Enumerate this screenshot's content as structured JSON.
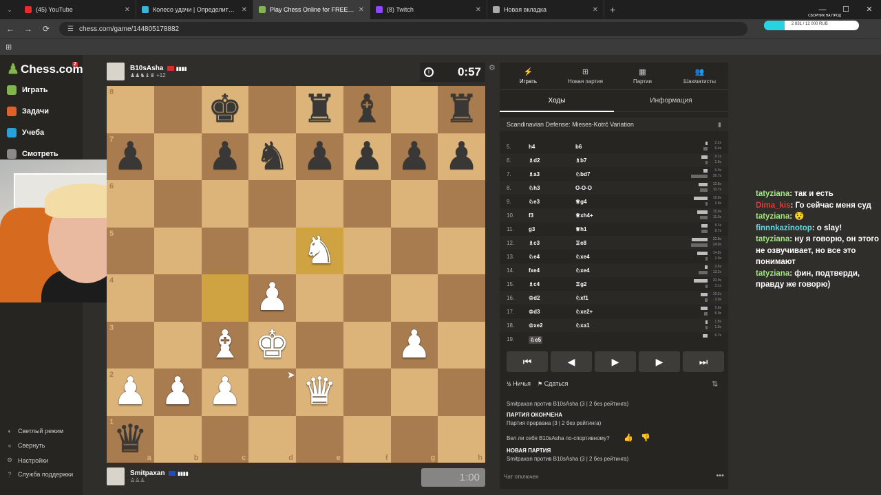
{
  "browser": {
    "tabs": [
      {
        "title": "(45) YouTube",
        "color": "#e52d27",
        "active": false
      },
      {
        "title": "Колесо удачи | Определите пс",
        "color": "#3bb3e0",
        "active": false
      },
      {
        "title": "Play Chess Online for FREE - 2",
        "color": "#81b64c",
        "active": true
      },
      {
        "title": "(8) Twitch",
        "color": "#9146ff",
        "active": false
      },
      {
        "title": "Новая вкладка",
        "color": "#aaa",
        "active": false
      }
    ],
    "url": "chess.com/game/144805178882",
    "promo_title": "СБОРНИК НА ПРОД",
    "promo_text": "2 831 / 12 000 RUB"
  },
  "sidebar": {
    "logo": "Chess.com",
    "badge": "2",
    "items": [
      {
        "label": "Играть",
        "color": "#81b64c"
      },
      {
        "label": "Задачи",
        "color": "#e0622a"
      },
      {
        "label": "Учеба",
        "color": "#27a1d8"
      },
      {
        "label": "Смотреть",
        "color": "#8a8a8a"
      }
    ],
    "bottom": [
      {
        "label": "Светлый режим",
        "icon": "◐"
      },
      {
        "label": "Свернуть",
        "icon": "«"
      },
      {
        "label": "Настройки",
        "icon": "⚙"
      },
      {
        "label": "Служба поддержки",
        "icon": "?"
      }
    ]
  },
  "top_player": {
    "name": "B10sAsha",
    "extra": "+12",
    "material": "♟♟♞♝♛",
    "clock": "0:57",
    "flag": "#d32f2f"
  },
  "bottom_player": {
    "name": "Smitpaxan",
    "material": "♙♙♙",
    "clock": "1:00",
    "flag": "#1e4cc4"
  },
  "board": {
    "ranks": [
      "8",
      "7",
      "6",
      "5",
      "4",
      "3",
      "2",
      "1"
    ],
    "files": [
      "a",
      "b",
      "c",
      "d",
      "e",
      "f",
      "g",
      "h"
    ],
    "pieces": [
      {
        "sq": "c8",
        "p": "♚",
        "c": "b"
      },
      {
        "sq": "e8",
        "p": "♜",
        "c": "b"
      },
      {
        "sq": "f8",
        "p": "♝",
        "c": "b"
      },
      {
        "sq": "h8",
        "p": "♜",
        "c": "b"
      },
      {
        "sq": "a7",
        "p": "♟",
        "c": "b"
      },
      {
        "sq": "c7",
        "p": "♟",
        "c": "b"
      },
      {
        "sq": "d7",
        "p": "♞",
        "c": "b"
      },
      {
        "sq": "e7",
        "p": "♟",
        "c": "b"
      },
      {
        "sq": "f7",
        "p": "♟",
        "c": "b"
      },
      {
        "sq": "g7",
        "p": "♟",
        "c": "b"
      },
      {
        "sq": "h7",
        "p": "♟",
        "c": "b"
      },
      {
        "sq": "e5",
        "p": "♞",
        "c": "w"
      },
      {
        "sq": "d4",
        "p": "♟",
        "c": "w"
      },
      {
        "sq": "c3",
        "p": "♝",
        "c": "w"
      },
      {
        "sq": "d3",
        "p": "♚",
        "c": "w"
      },
      {
        "sq": "g3",
        "p": "♟",
        "c": "w"
      },
      {
        "sq": "a2",
        "p": "♟",
        "c": "w"
      },
      {
        "sq": "b2",
        "p": "♟",
        "c": "w"
      },
      {
        "sq": "c2",
        "p": "♟",
        "c": "w"
      },
      {
        "sq": "e2",
        "p": "♛",
        "c": "w"
      },
      {
        "sq": "a1",
        "p": "♛",
        "c": "b"
      }
    ],
    "highlights": [
      "e5",
      "c4"
    ]
  },
  "panel": {
    "tabs": [
      {
        "label": "Играть",
        "icon": "⚡",
        "active": true
      },
      {
        "label": "Новая партия",
        "icon": "⊞",
        "active": false
      },
      {
        "label": "Партии",
        "icon": "▦",
        "active": false
      },
      {
        "label": "Шахматисты",
        "icon": "👥",
        "active": false
      }
    ],
    "subtabs": [
      {
        "label": "Ходы",
        "active": true
      },
      {
        "label": "Информация",
        "active": false
      }
    ],
    "opening": "Scandinavian Defense: Mieses-Kotrč Variation",
    "moves": [
      {
        "n": "5.",
        "w": "h4",
        "b": "b6",
        "wt": "2.2s",
        "bt": "6.4s"
      },
      {
        "n": "6.",
        "w": "♗d2",
        "b": "♗b7",
        "wt": "9.1s",
        "bt": "1.9s"
      },
      {
        "n": "7.",
        "w": "♗a3",
        "b": "♘bd7",
        "wt": "6.3s",
        "bt": "26.7s"
      },
      {
        "n": "8.",
        "w": "♘h3",
        "b": "O-O-O",
        "wt": "12.8s",
        "bt": "10.7s"
      },
      {
        "n": "9.",
        "w": "♘e3",
        "b": "♕g4",
        "wt": "19.9s",
        "bt": "1.9s"
      },
      {
        "n": "10.",
        "w": "f3",
        "b": "♕xh4+",
        "wt": "15.0s",
        "bt": "11.3s"
      },
      {
        "n": "11.",
        "w": "g3",
        "b": "♕h1",
        "wt": "9.1s",
        "bt": "8.7s"
      },
      {
        "n": "12.",
        "w": "♗c3",
        "b": "♖e8",
        "wt": "22.8s",
        "bt": "24.9s"
      },
      {
        "n": "13.",
        "w": "♘e4",
        "b": "♘xe4",
        "wt": "14.8s",
        "bt": "1.9s"
      },
      {
        "n": "14.",
        "w": "fxe4",
        "b": "♘xe4",
        "wt": "3.6s",
        "bt": "13.2s"
      },
      {
        "n": "15.",
        "w": "♗c4",
        "b": "♖g2",
        "wt": "20.0s",
        "bt": "3.1s"
      },
      {
        "n": "16.",
        "w": "♔d2",
        "b": "♘xf1",
        "wt": "10.2s",
        "bt": "3.9s"
      },
      {
        "n": "17.",
        "w": "♔d3",
        "b": "♘xe2+",
        "wt": "9.8s",
        "bt": "5.0s"
      },
      {
        "n": "18.",
        "w": "♔xe2",
        "b": "♘xa1",
        "wt": "1.8s",
        "bt": "1.9s"
      },
      {
        "n": "19.",
        "w": "♘e5",
        "b": "",
        "wt": "6.7s",
        "bt": ""
      }
    ],
    "controls": [
      "⏮",
      "◀",
      "▶",
      "▶",
      "⏭"
    ],
    "draw_label": "Ничья",
    "resign_label": "Сдаться",
    "log": [
      {
        "text": "Smitpaxan против B10sAsha (3 | 2 без рейтинга)",
        "hdr": false
      },
      {
        "text": "ПАРТИЯ ОКОНЧЕНА",
        "hdr": true
      },
      {
        "text": "Партия прервана (3 | 2 без рейтинга)",
        "hdr": false
      },
      {
        "text": "Вел ли себя B10sAsha по-спортивному?",
        "hdr": false
      },
      {
        "text": "НОВАЯ ПАРТИЯ",
        "hdr": true
      },
      {
        "text": "Smitpaxan против B10sAsha (3 | 2 без рейтинга)",
        "hdr": false
      }
    ],
    "chat_disabled": "Чат отключен"
  },
  "chat": [
    {
      "user": "tatyziana",
      "msg": "так и есть",
      "color": "green"
    },
    {
      "user": "Dima_kis",
      "msg": "Го сейчас меня суд",
      "color": "red"
    },
    {
      "user": "tatyziana",
      "msg": "😯",
      "color": "green"
    },
    {
      "user": "finnnkazinotop",
      "msg": "o slay!",
      "color": "cyan"
    },
    {
      "user": "tatyziana",
      "msg": "ну я говорю, он этого не озвучивает, но все это понимают",
      "color": "green"
    },
    {
      "user": "tatyziana",
      "msg": "фин, подтверди, правду же говорю)",
      "color": "green"
    }
  ]
}
